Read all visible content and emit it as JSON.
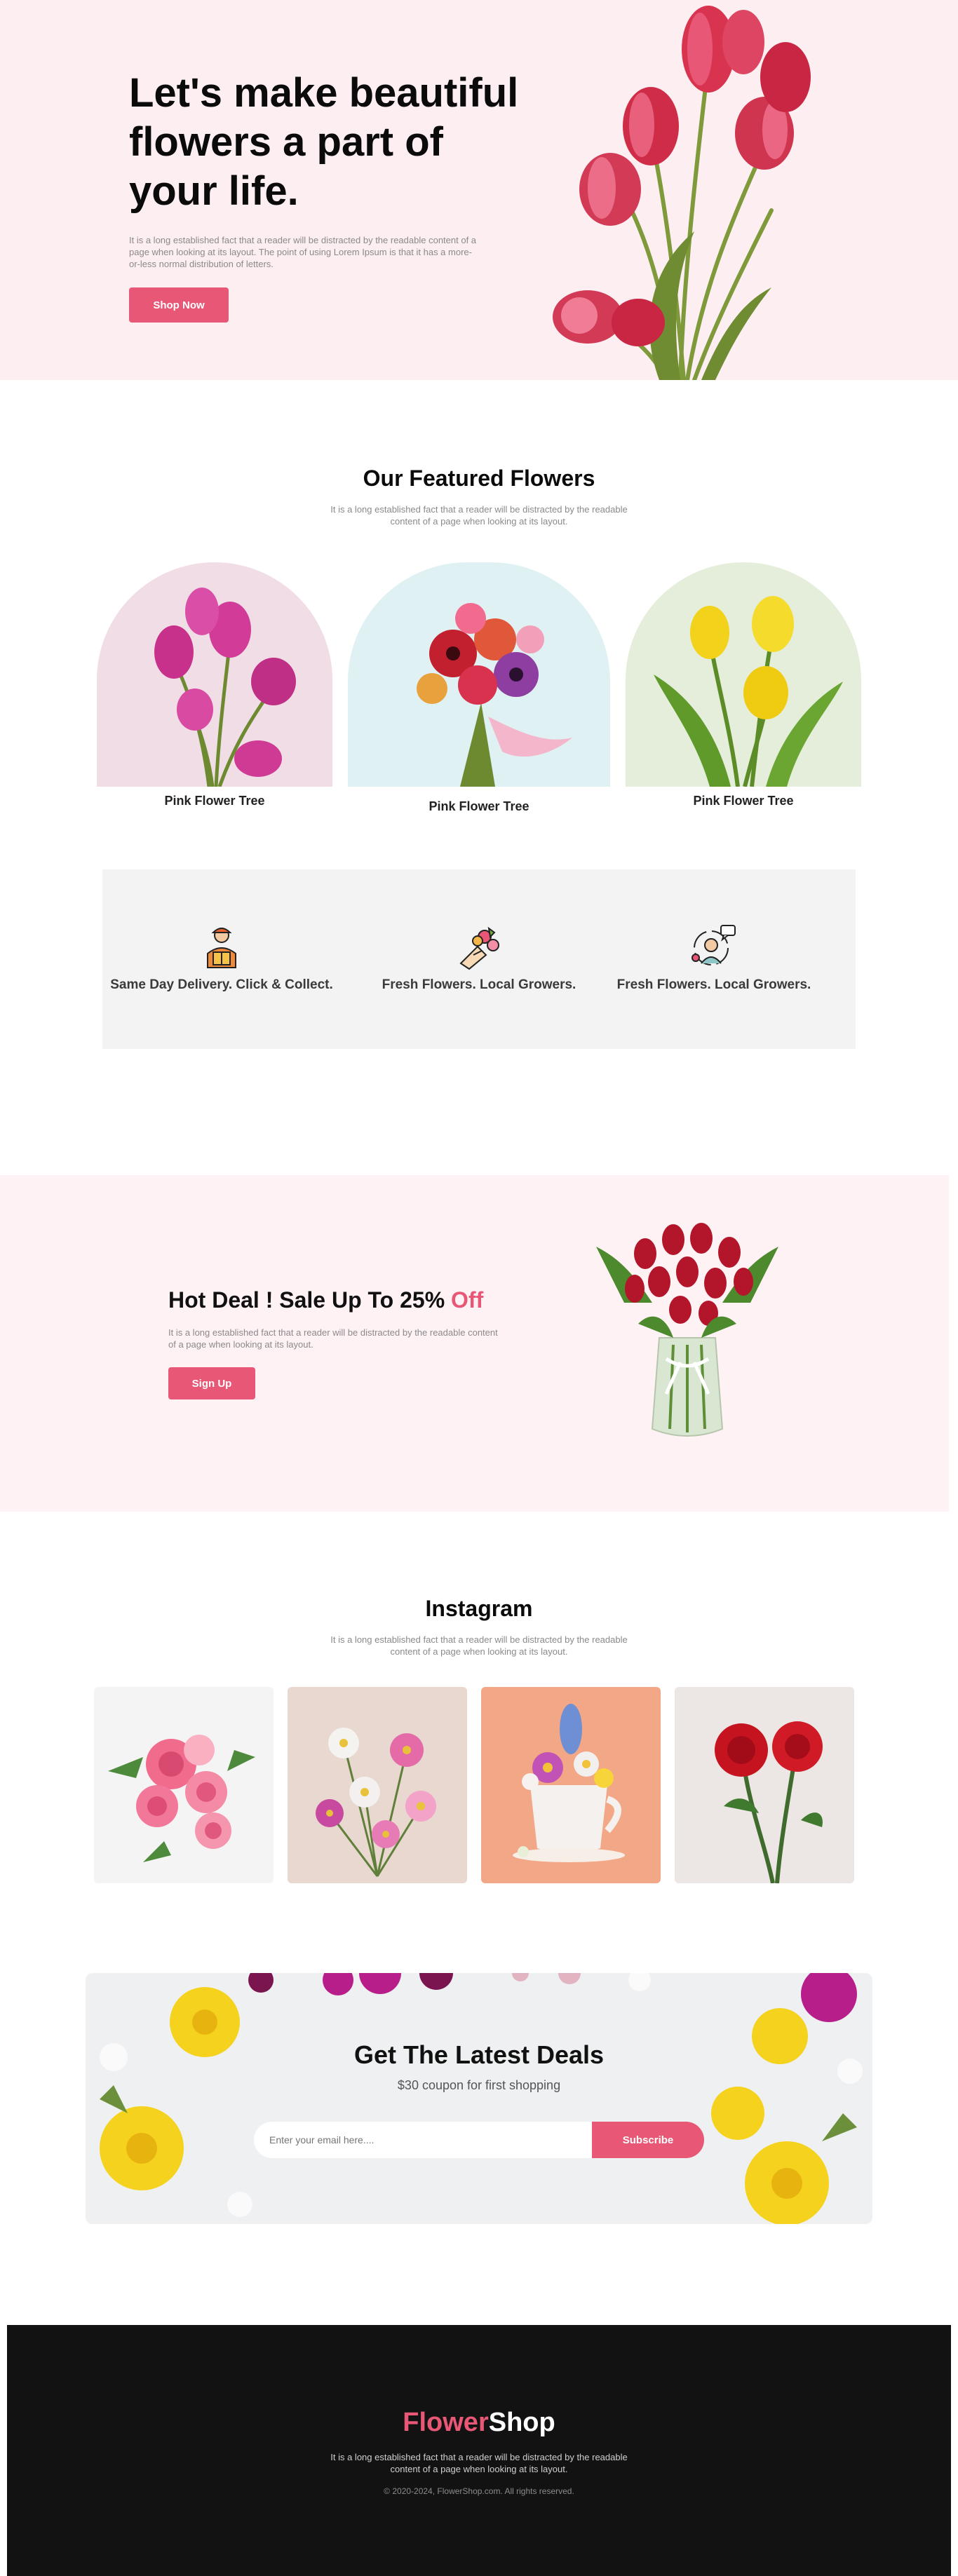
{
  "hero": {
    "title": "Let's make beautiful flowers a part of your life.",
    "text": "It is a long established fact that a reader will be distracted by the readable content of a page when looking at its layout. The point of using Lorem Ipsum is that it has a more-or-less normal distribution of letters.",
    "button": "Shop Now"
  },
  "featured": {
    "title": "Our Featured Flowers",
    "subtitle": "It is a long established fact that a reader will be distracted by the readable content of a page when looking at its layout.",
    "cards": [
      {
        "label": "Pink Flower Tree"
      },
      {
        "label": "Pink Flower Tree"
      },
      {
        "label": "Pink Flower Tree"
      }
    ]
  },
  "features": [
    {
      "label": "Same Day Delivery. Click & Collect.",
      "icon": "delivery-person-icon"
    },
    {
      "label": "Fresh Flowers. Local Growers.",
      "icon": "bouquet-icon"
    },
    {
      "label": "Fresh Flowers. Local Growers.",
      "icon": "support-agent-icon"
    }
  ],
  "deal": {
    "title_main": "Hot Deal ! Sale Up To 25% ",
    "title_highlight": "Off",
    "text": "It is a long established fact that a reader will be distracted by the readable content of a page when looking at its layout.",
    "button": "Sign Up"
  },
  "instagram": {
    "title": "Instagram",
    "subtitle": "It is a long established fact that a reader will be distracted by the readable content of a page when looking at its layout."
  },
  "newsletter": {
    "title": "Get The Latest Deals",
    "subtitle": "$30 coupon for first shopping",
    "placeholder": "Enter your email here....",
    "button": "Subscribe"
  },
  "footer": {
    "logo_part1": "Flower",
    "logo_part2": "Shop",
    "text": "It is a long established fact that a reader will be distracted by the readable content of a page when looking at its layout.",
    "copyright": "© 2020-2024, FlowerShop.com. All rights reserved."
  },
  "colors": {
    "accent": "#e85775",
    "hero_bg": "#fdeef1",
    "deal_bg": "#fff2f5",
    "strip_bg": "#f3f3f3",
    "footer_bg": "#121212"
  }
}
